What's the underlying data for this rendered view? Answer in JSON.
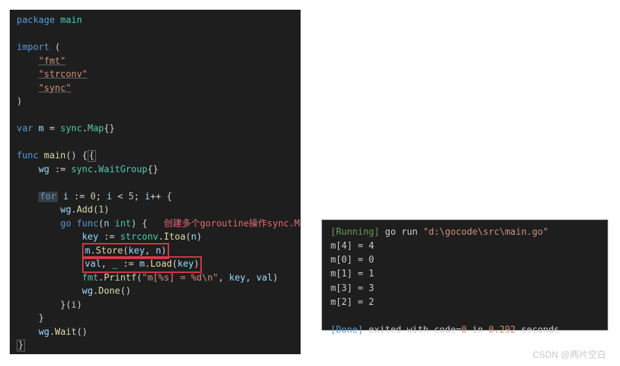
{
  "code": {
    "l1_kw1": "package",
    "l1_pkg": " main",
    "l3_kw": "import",
    "l3_paren": " (",
    "l4_str": "\"fmt\"",
    "l5_str": "\"strconv\"",
    "l6_str": "\"sync\"",
    "l7_paren": ")",
    "l9_kw": "var",
    "l9_var": " m ",
    "l9_op": "=",
    "l9_pkg": " sync",
    "l9_dot": ".",
    "l9_type": "Map",
    "l9_braces": "{}",
    "l11_kw": "func",
    "l11_fn": " main",
    "l11_paren": "()",
    "l11_brace": " {",
    "l12_indent": "    ",
    "l12_var": "wg",
    "l12_op": " := ",
    "l12_pkg": "sync",
    "l12_dot": ".",
    "l12_type": "WaitGroup",
    "l12_braces": "{}",
    "l14_indent": "    ",
    "l14_for": "for",
    "l14_rest1": " i ",
    "l14_op1": ":=",
    "l14_num1": " 0",
    "l14_semi1": "; ",
    "l14_var2": "i ",
    "l14_op2": "< ",
    "l14_num2": "5",
    "l14_semi2": "; ",
    "l14_var3": "i",
    "l14_op3": "++",
    "l14_brace": " {",
    "l15_indent": "        ",
    "l15_var": "wg",
    "l15_dot": ".",
    "l15_fn": "Add",
    "l15_paren1": "(",
    "l15_num": "1",
    "l15_paren2": ")",
    "l16_indent": "        ",
    "l16_kw": "go",
    "l16_sp": " ",
    "l16_kw2": "func",
    "l16_paren1": "(",
    "l16_var": "n",
    "l16_sp2": " ",
    "l16_type": "int",
    "l16_paren2": ")",
    "l16_brace": " {",
    "l16_comment": "创建多个goroutine操作sync.Map",
    "l17_indent": "            ",
    "l17_var": "key",
    "l17_op": " := ",
    "l17_pkg": "strconv",
    "l17_dot": ".",
    "l17_fn": "Itoa",
    "l17_paren1": "(",
    "l17_arg": "n",
    "l17_paren2": ")",
    "l18_indent": "            ",
    "l18_box": "m.Store(key, n)",
    "l19_indent": "            ",
    "l19_box": "val, _ := m.Load(key)",
    "l20_indent": "            ",
    "l20_pkg": "fmt",
    "l20_dot": ".",
    "l20_fn": "Printf",
    "l20_paren1": "(",
    "l20_str": "\"m[%s] = %d\\n\"",
    "l20_comma": ", ",
    "l20_arg1": "key",
    "l20_comma2": ", ",
    "l20_arg2": "val",
    "l20_paren2": ")",
    "l21_indent": "            ",
    "l21_var": "wg",
    "l21_dot": ".",
    "l21_fn": "Done",
    "l21_paren": "()",
    "l22_indent": "        ",
    "l22_brace": "}",
    "l22_paren1": "(",
    "l22_var": "i",
    "l22_paren2": ")",
    "l23_indent": "    ",
    "l23_brace": "}",
    "l24_indent": "    ",
    "l24_var": "wg",
    "l24_dot": ".",
    "l24_fn": "Wait",
    "l24_paren": "()",
    "l25_brace": "}"
  },
  "terminal": {
    "running_label": "[Running]",
    "running_cmd": " go run ",
    "running_path": "\"d:\\gocode\\src\\main.go\"",
    "out1": "m[4] = 4",
    "out2": "m[0] = 0",
    "out3": "m[1] = 1",
    "out4": "m[3] = 3",
    "out5": "m[2] = 2",
    "done_label": "[Done]",
    "done_text1": " exited with code=",
    "done_code": "0",
    "done_text2": " in ",
    "done_time": "0.292",
    "done_text3": " seconds"
  },
  "watermark": "CSDN @两片空白"
}
